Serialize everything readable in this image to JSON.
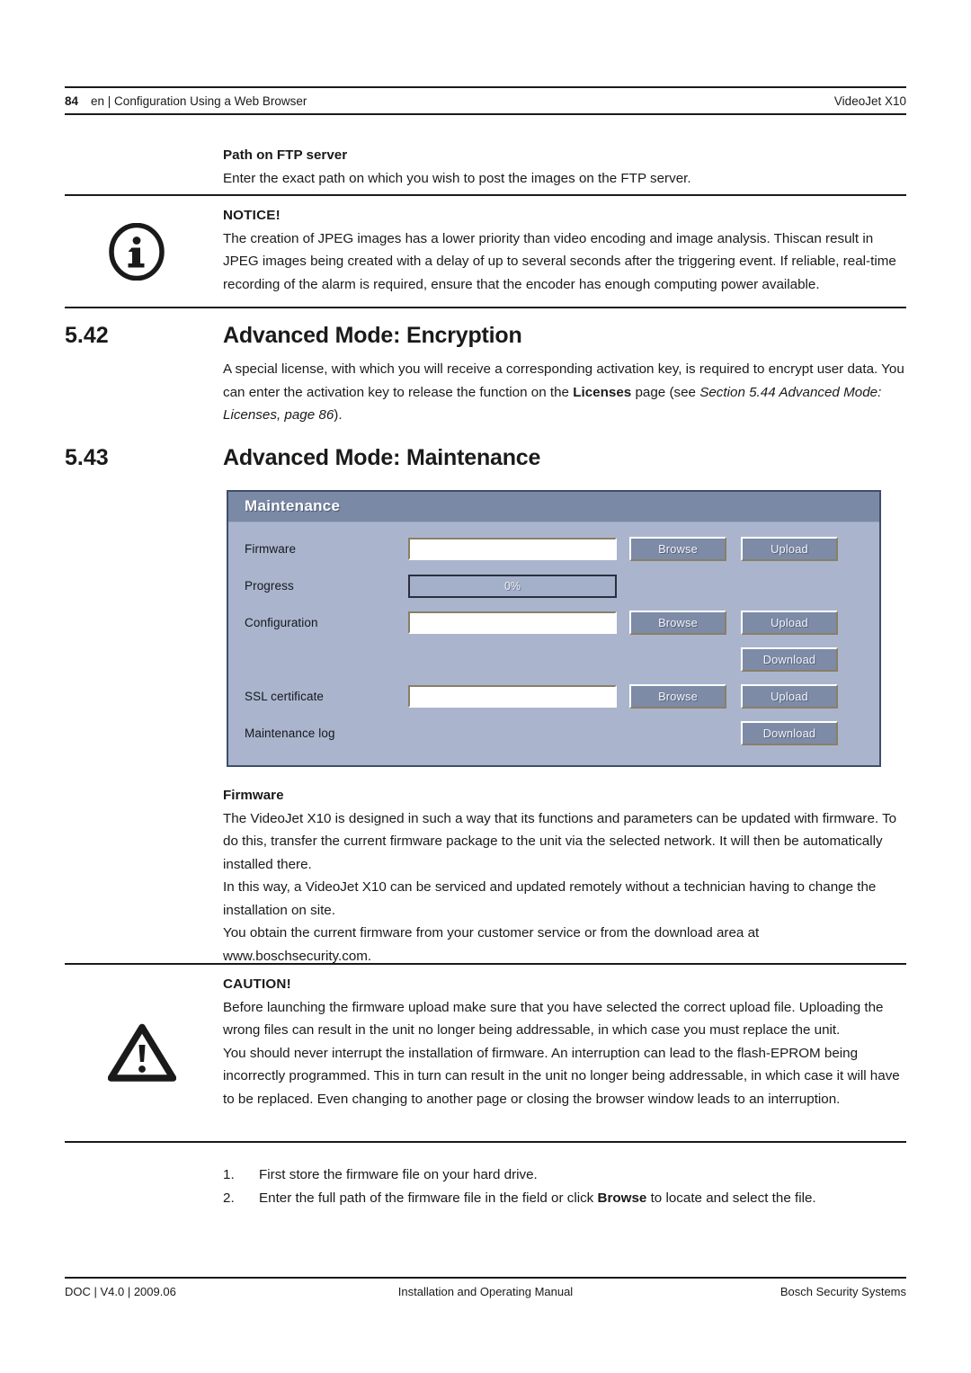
{
  "header": {
    "page_number": "84",
    "left_text": "en | Configuration Using a Web Browser",
    "right_text": "VideoJet X10"
  },
  "ftp": {
    "heading": "Path on FTP server",
    "paragraph": "Enter the exact path on which you wish to post the images on the FTP server."
  },
  "notice": {
    "icon": "info-circle-icon",
    "title": "NOTICE!",
    "paragraph": "The creation of JPEG images has a lower priority than video encoding and image analysis. Thiscan result in JPEG images being created with a delay of up to several seconds after the triggering event. If reliable, real-time recording of the alarm is required, ensure that the encoder has enough computing power available."
  },
  "section_encryption": {
    "number": "5.42",
    "title": "Advanced Mode: Encryption",
    "para_part1": "A special license, with which you will receive a corresponding activation key, is required to encrypt user data. You can enter the activation key to release the function on the ",
    "para_bold": "Licenses",
    "para_part2": " page (see ",
    "para_italic": "Section 5.44 Advanced Mode: Licenses, page 86",
    "para_part3": ")."
  },
  "section_maintenance": {
    "number": "5.43",
    "title": "Advanced Mode: Maintenance"
  },
  "ui_panel": {
    "title": "Maintenance",
    "colors": {
      "titlebar": "#7a89a6",
      "body": "#aab5cd",
      "button": "#7d8ba7",
      "border": "#3f4d6e"
    },
    "rows": [
      {
        "label": "Firmware",
        "field": "input",
        "field_value": "",
        "buttons": [
          "Browse",
          "Upload"
        ]
      },
      {
        "label": "Progress",
        "field": "progress",
        "field_value": "0%",
        "buttons": []
      },
      {
        "label": "Configuration",
        "field": "input",
        "field_value": "",
        "buttons": [
          "Browse",
          "Upload"
        ]
      },
      {
        "label": "",
        "field": "none",
        "field_value": "",
        "buttons": [
          "Download"
        ]
      },
      {
        "label": "SSL certificate",
        "field": "input",
        "field_value": "",
        "buttons": [
          "Browse",
          "Upload"
        ]
      },
      {
        "label": "Maintenance log",
        "field": "none",
        "field_value": "",
        "buttons": [
          "Download"
        ]
      }
    ]
  },
  "firmware": {
    "heading": "Firmware",
    "para1": "The VideoJet X10 is designed in such a way that its functions and parameters can be updated with firmware. To do this, transfer the current firmware package to the unit via the selected network. It will then be automatically installed there.",
    "para2": "In this way, a VideoJet X10 can be serviced and updated remotely without a technician having to change the installation on site.",
    "para3": "You obtain the current firmware from your customer service or from the download area at www.boschsecurity.com."
  },
  "caution": {
    "icon": "warning-triangle-icon",
    "title": "CAUTION!",
    "para1": "Before launching the firmware upload make sure that you have selected the correct upload file. Uploading the wrong files can result in the unit no longer being addressable, in which case you must replace the unit.",
    "para2": "You should never interrupt the installation of firmware. An interruption can lead to the flash-EPROM being incorrectly programmed. This in turn can result in the unit no longer being addressable, in which case it will have to be replaced. Even changing to another page or closing the browser window leads to an interruption."
  },
  "steps": [
    {
      "marker": "1.",
      "text_part1": "First store the firmware file on your hard drive.",
      "text_bold": "",
      "text_part2": ""
    },
    {
      "marker": "2.",
      "text_part1": "Enter the full path of the firmware file in the field or click ",
      "text_bold": "Browse",
      "text_part2": " to locate and select the file."
    }
  ],
  "footer": {
    "left": "DOC | V4.0 | 2009.06",
    "center": "Installation and Operating Manual",
    "right": "Bosch Security Systems"
  }
}
